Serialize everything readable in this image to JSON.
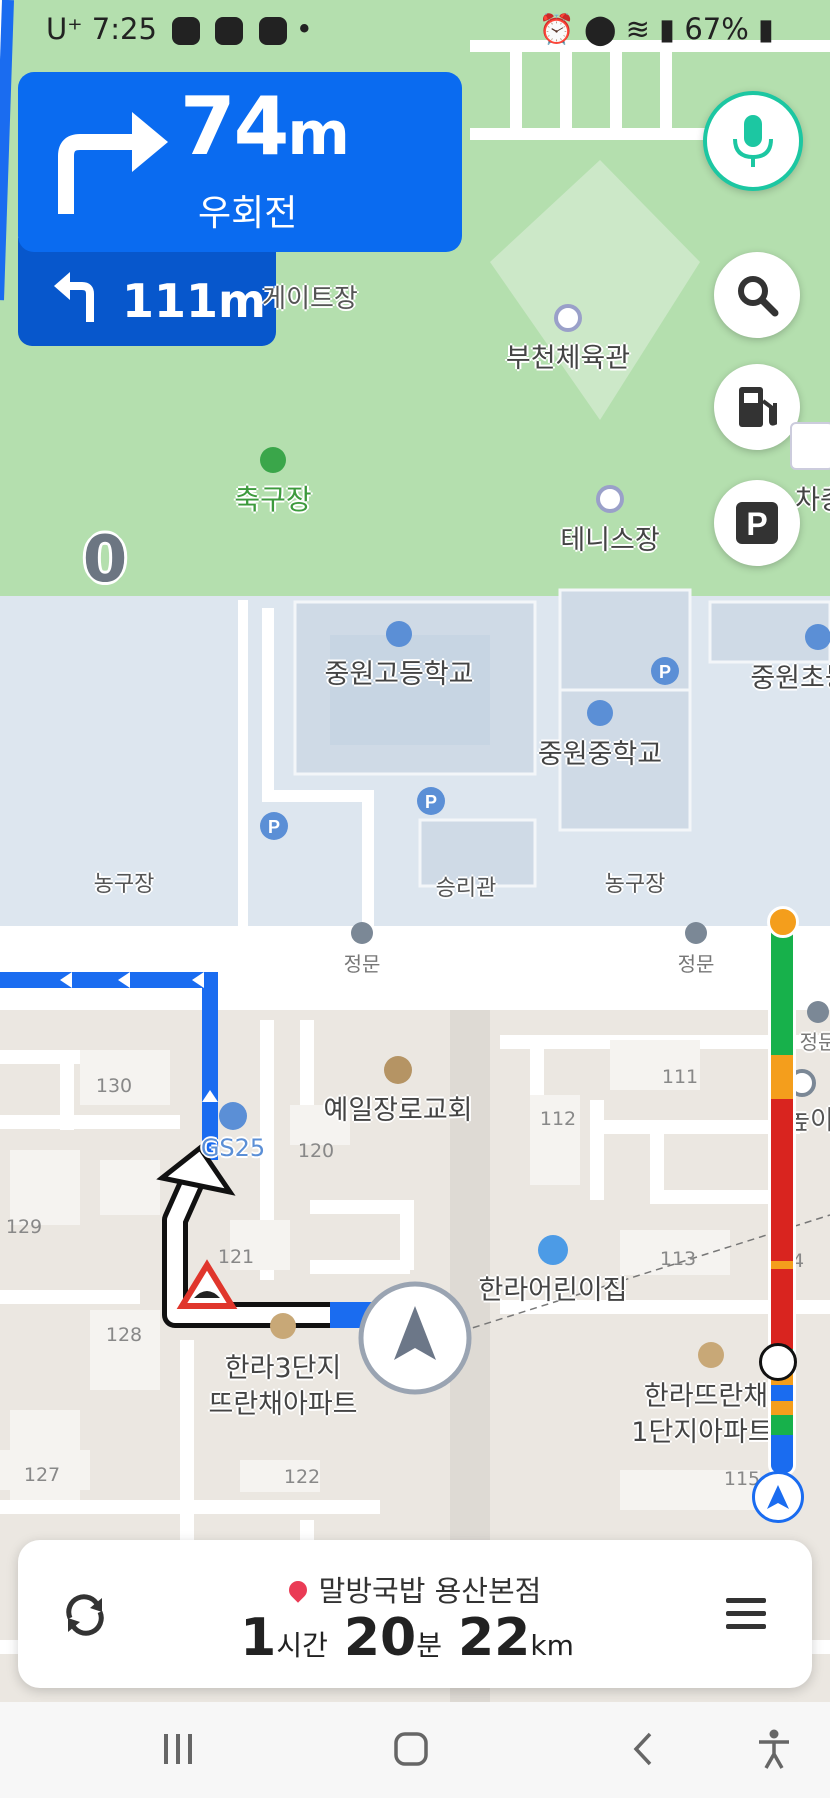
{
  "status_bar": {
    "carrier": "U⁺",
    "time": "7:25",
    "battery": "67%"
  },
  "guidance": {
    "primary_distance": "74",
    "primary_unit": "m",
    "primary_instruction": "우회전",
    "secondary_distance": "111m"
  },
  "current_speed": "0",
  "map_labels": {
    "gate_field": "게이트장",
    "gymnasium": "부천체육관",
    "soccer_field": "축구장",
    "tennis_court": "테니스장",
    "charging_partial": "차충",
    "high_school": "중원고등학교",
    "middle_school": "중원중학교",
    "elementary_partial": "중원초등",
    "basketball_left": "농구장",
    "victory_hall": "승리관",
    "basketball_right": "농구장",
    "main_gate_left": "정문",
    "main_gate_right": "정문",
    "main_gate_far": "정문",
    "church": "예일장로교회",
    "gs25": "GS25",
    "kindergarten": "한라어린이집",
    "high_partial": "높이",
    "apt3_line1": "한라3단지",
    "apt3_line2": "뜨란채아파트",
    "apt1_line1": "한라뜨란채",
    "apt1_line2": "1단지아파트"
  },
  "building_numbers": [
    "130",
    "120",
    "129",
    "121",
    "128",
    "127",
    "122",
    "111",
    "112",
    "113",
    "115",
    "4"
  ],
  "destination": {
    "name": "말방국밥 용산본점",
    "hours": "1",
    "hours_unit": "시간",
    "minutes": "20",
    "minutes_unit": "분",
    "distance": "22",
    "distance_unit": "km"
  },
  "icons": {
    "mic": "mic-icon",
    "search": "search-icon",
    "fuel": "fuel-icon",
    "parking": "parking-icon",
    "reroute": "reroute-icon",
    "menu": "menu-icon"
  },
  "colors": {
    "route_blue": "#1a6cf0",
    "park_green": "#a9d8a1",
    "school_blue": "#dce7f1",
    "traffic_green": "#17b14b",
    "traffic_orange": "#f49e1c",
    "traffic_red": "#d9241f"
  }
}
